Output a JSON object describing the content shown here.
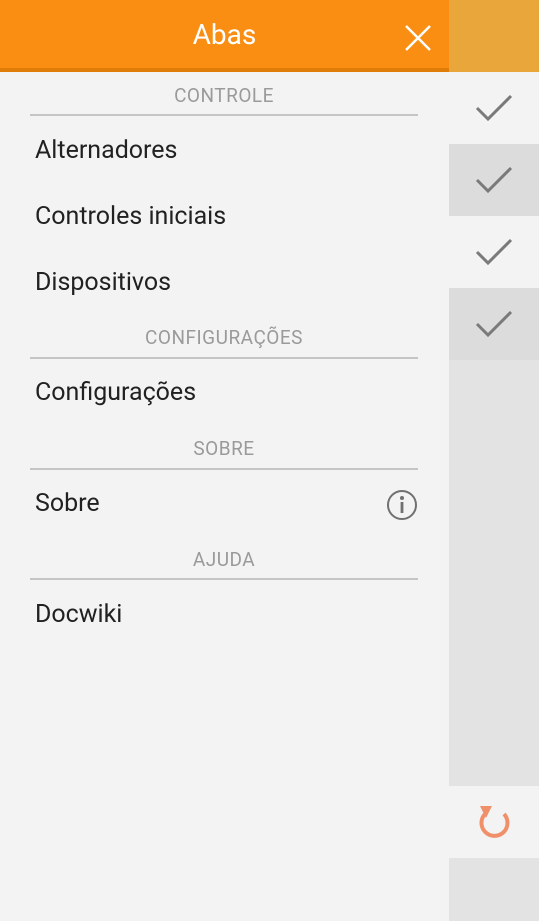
{
  "drawer": {
    "title": "Abas",
    "sections": [
      {
        "header": "CONTROLE",
        "items": [
          "Alternadores",
          "Controles iniciais",
          "Dispositivos"
        ]
      },
      {
        "header": "CONFIGURAÇÕES",
        "items": [
          "Configurações"
        ]
      },
      {
        "header": "SOBRE",
        "items": [
          "Sobre"
        ]
      },
      {
        "header": "AJUDA",
        "items": [
          "Docwiki"
        ]
      }
    ]
  },
  "icons": {
    "close": "close-icon",
    "info": "info-icon",
    "check": "checkmark-icon",
    "refresh": "refresh-icon"
  },
  "colors": {
    "header": "#f98e12",
    "header_right": "#e8a63b",
    "refresh": "#f0906a"
  }
}
